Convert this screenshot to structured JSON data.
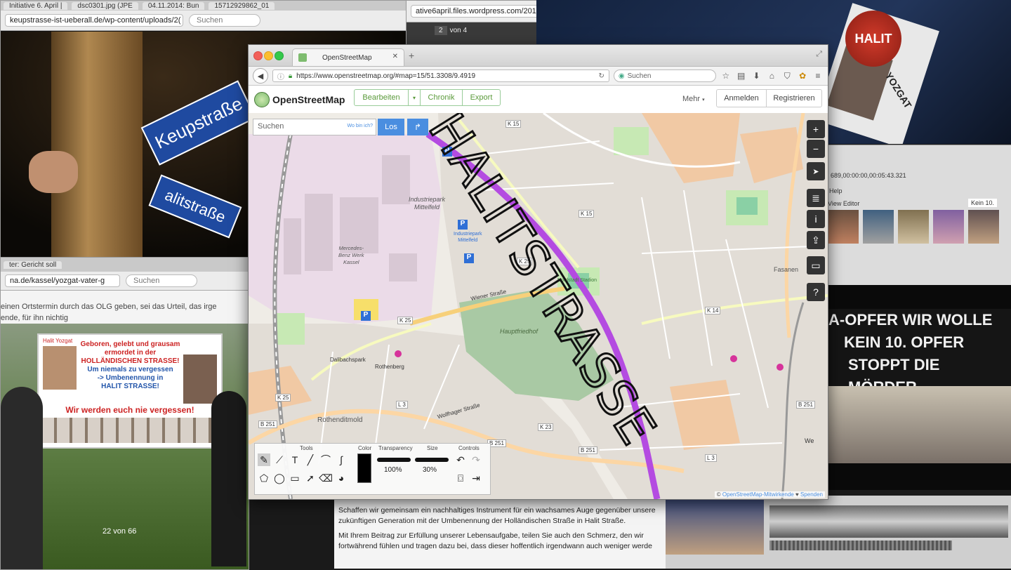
{
  "bg_topleft": {
    "tabs": [
      "Initiative 6. April |",
      "dsc0301.jpg (JPE",
      "04.11.2014: Bun",
      "15712929862_01"
    ],
    "url": "keupstrasse-ist-ueberall.de/wp-content/uploads/2(",
    "search_placeholder": "Suchen",
    "street_sign_1": "Keupstraße",
    "street_sign_2": "alitstraße"
  },
  "bg_topmid": {
    "url": "ative6april.files.wordpress.com/201",
    "page_current": "2",
    "page_total": "von 4"
  },
  "bg_topright": {
    "button_text": "HALIT",
    "label": "HALIT",
    "label2": "YOZGAT"
  },
  "bg_right": {
    "timecode": "689,00:00:00,00:05:43.321",
    "menu": "Help",
    "editor": "View Editor",
    "zoom": "Kein 10.",
    "banner_line1": "A-OPFER WIR WOLLE",
    "banner_line2": "KEIN 10. OPFER",
    "banner_line3": "STOPPT DIE MÖRDER"
  },
  "bg_bottomleft": {
    "tab": "ter: Gericht soll",
    "url": "na.de/kassel/yozgat-vater-g",
    "search_placeholder": "Suchen",
    "article_line1": "einen Ortstermin durch das OLG geben, sei das Urteil, das irge",
    "article_line2": "ende, für ihn nichtig",
    "sign_title": "Halit Yozgat",
    "sign_line1": "Geboren, gelebt und grausam",
    "sign_line2": "ermordet in der",
    "sign_line3": "HOLLÄNDISCHEN STRASSE!",
    "sign_line4": "Um niemals zu vergessen",
    "sign_line5": "-> Umbenennung in",
    "sign_line6": "HALIT STRASSE!",
    "sign_line7": "Wir werden euch nie vergessen!",
    "counter": "22 von 66"
  },
  "bg_bottom": {
    "line1": "Schaffen wir gemeinsam ein nachhaltiges Instrument für ein wachsames Auge gegenüber unsere",
    "line2": "zukünftigen Generation mit der Umbenennung der Holländischen Straße in Halit Straße.",
    "line3": "Mit Ihrem Beitrag zur Erfüllung unserer Lebensaufgabe, teilen Sie auch den Schmerz, den wir",
    "line4": "fortwährend fühlen und tragen dazu bei, dass dieser hoffentlich irgendwann auch weniger werde"
  },
  "browser": {
    "tab_title": "OpenStreetMap",
    "url": "https://www.openstreetmap.org/#map=15/51.3308/9.4919",
    "search_placeholder": "Suchen"
  },
  "osm": {
    "logo": "OpenStreetMap",
    "edit": "Bearbeiten",
    "history": "Chronik",
    "export": "Export",
    "more": "Mehr",
    "login": "Anmelden",
    "register": "Registrieren",
    "search_placeholder": "Suchen",
    "where_am_i": "Wo bin ich?",
    "go": "Los",
    "attribution_link1": "OpenStreetMap-Mitwirkende",
    "attribution_sep": "♥",
    "attribution_link2": "Spenden"
  },
  "map_labels": {
    "industrial_park": "Industriepark",
    "industrial_park2": "Mittelfeld",
    "mercedes1": "Mercedes-",
    "mercedes2": "Benz Werk",
    "mercedes3": "Kassel",
    "ip_p1": "Industriepark",
    "ip_p2": "Mittelfeld",
    "wiener": "Wiener Straße",
    "hauptfriedhof": "Hauptfriedhof",
    "rothenberg": "Rothenberg",
    "rothenditmold": "Rothenditmold",
    "dalibuck": "Dalibachspark",
    "wolfhager": "Wolfhager Straße",
    "fasanen": "Fasanen",
    "nordstad": "Nordstadt Stadion",
    "k15a": "K 15",
    "k15b": "K 15",
    "k25a": "K 25",
    "k25b": "K 25",
    "k25c": "K 25",
    "k14": "K 14",
    "b251a": "B 251",
    "b251b": "B 251",
    "b251c": "B 251",
    "b251d": "B 251",
    "l3": "L 3",
    "l3b": "L 3",
    "k23": "K 23",
    "we": "We"
  },
  "graffiti": {
    "text": "HALITSTRASSE"
  },
  "drawpanel": {
    "tools": "Tools",
    "color": "Color",
    "transparency": "Transparency",
    "transparency_value": "100%",
    "size": "Size",
    "size_value": "30%",
    "controls": "Controls",
    "text_tool": "T"
  },
  "map_controls": [
    "+",
    "−",
    "➤",
    "≣",
    "i",
    "⇪",
    "▭",
    "?"
  ],
  "colors": {
    "route": "#b44be1",
    "osm_green": "#5a9a3a",
    "go_blue": "#4a8ee0",
    "industrial": "#e8d6e8",
    "cemetery": "#a9c9a4"
  }
}
